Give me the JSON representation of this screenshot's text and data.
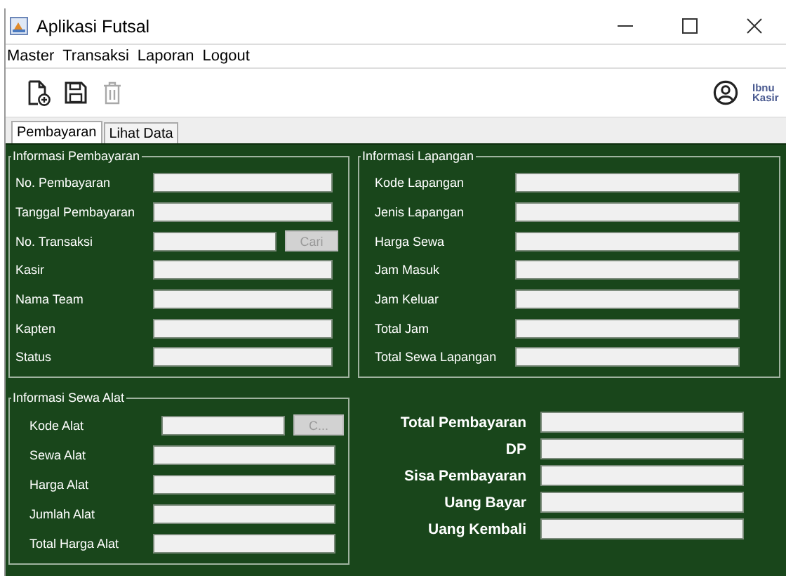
{
  "window": {
    "title": "Aplikasi Futsal"
  },
  "menu": [
    "Master",
    "Transaksi",
    "Laporan",
    "Logout"
  ],
  "toolbar": [
    {
      "kind": "new",
      "disabled": false
    },
    {
      "kind": "save",
      "disabled": false
    },
    {
      "kind": "delete",
      "disabled": true
    }
  ],
  "user_label": "Ibnu Kasir",
  "tabs": [
    {
      "label": "Pembayaran",
      "selected": true
    },
    {
      "label": "Lihat Data",
      "selected": false
    }
  ],
  "groups": [
    {
      "title": "Informasi Pembayaran",
      "fields": [
        {
          "label": "No. Pembayaran"
        },
        {
          "label": "Tanggal Pembayaran"
        },
        {
          "label": "No. Transaksi",
          "button": {
            "label": "Cari",
            "disabled": true
          }
        },
        {
          "label": "Kasir"
        },
        {
          "label": "Nama Team"
        },
        {
          "label": "Kapten"
        },
        {
          "label": "Status"
        }
      ]
    },
    {
      "title": "Informasi Lapangan",
      "fields": [
        {
          "label": "Kode Lapangan"
        },
        {
          "label": "Jenis Lapangan"
        },
        {
          "label": "Harga Sewa"
        },
        {
          "label": "Jam Masuk"
        },
        {
          "label": "Jam Keluar"
        },
        {
          "label": "Total Jam"
        },
        {
          "label": "Total Sewa Lapangan"
        }
      ]
    },
    {
      "title": "Informasi Sewa Alat",
      "fields": [
        {
          "label": "Kode Alat",
          "button": {
            "label": "C...",
            "disabled": true
          }
        },
        {
          "label": "Sewa Alat"
        },
        {
          "label": "Harga Alat"
        },
        {
          "label": "Jumlah Alat"
        },
        {
          "label": "Total Harga Alat"
        }
      ]
    }
  ],
  "totals": [
    {
      "label": "Total Pembayaran"
    },
    {
      "label": "DP"
    },
    {
      "label": "Sisa Pembayaran"
    },
    {
      "label": "Uang Bayar"
    },
    {
      "label": "Uang Kembali"
    }
  ]
}
